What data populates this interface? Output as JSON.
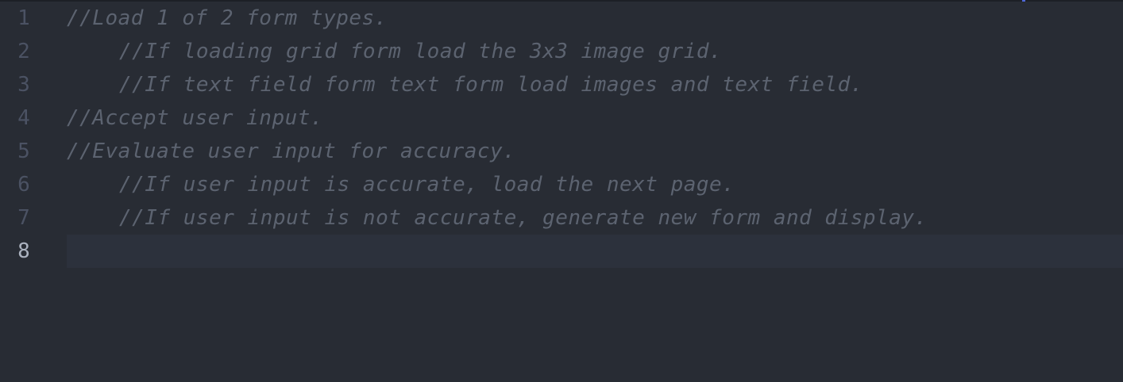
{
  "editor": {
    "lines": [
      {
        "number": "1",
        "text": "//Load 1 of 2 form types."
      },
      {
        "number": "2",
        "text": "//If loading grid form load the 3x3 image grid."
      },
      {
        "number": "3",
        "text": "//If text field form text form load images and text field."
      },
      {
        "number": "4",
        "text": "//Accept user input."
      },
      {
        "number": "5",
        "text": "//Evaluate user input for accuracy."
      },
      {
        "number": "6",
        "text": "//If user input is accurate, load the next page."
      },
      {
        "number": "7",
        "text": "//If user input is not accurate, generate new form and display."
      },
      {
        "number": "8",
        "text": ""
      }
    ],
    "active_line": "8"
  },
  "colors": {
    "background": "#282c34",
    "comment": "#5c6370",
    "gutter": "#4b5263",
    "active_gutter": "#abb2bf",
    "active_line_bg": "#2c313c",
    "accent": "#4f68d8"
  }
}
